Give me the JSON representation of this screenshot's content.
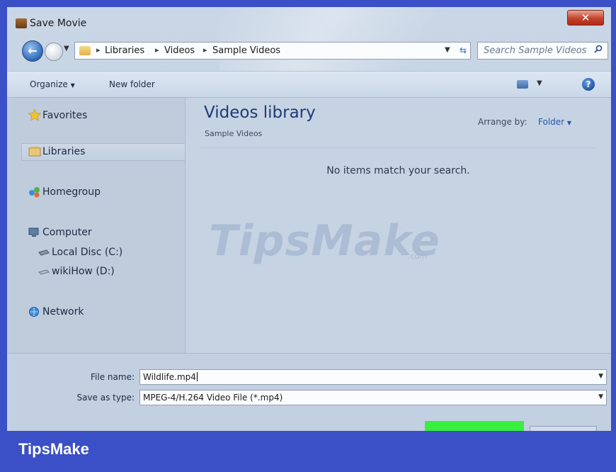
{
  "window": {
    "title": "Save Movie"
  },
  "nav": {
    "breadcrumb": [
      "Libraries",
      "Videos",
      "Sample Videos"
    ],
    "search_placeholder": "Search Sample Videos"
  },
  "toolbar": {
    "organize_label": "Organize",
    "new_folder_label": "New folder"
  },
  "sidebar": {
    "favorites": "Favorites",
    "libraries": "Libraries",
    "homegroup": "Homegroup",
    "computer": "Computer",
    "local_disc": "Local Disc (C:)",
    "wikihow_drive": "wikiHow (D:)",
    "network": "Network"
  },
  "content": {
    "title": "Videos library",
    "subtitle": "Sample Videos",
    "arrange_label": "Arrange by:",
    "arrange_value": "Folder",
    "empty_message": "No items match your search."
  },
  "form": {
    "file_name_label": "File name:",
    "file_name_value": "Wildlife.mp4",
    "save_type_label": "Save as type:",
    "save_type_value": "MPEG-4/H.264 Video File (*.mp4)"
  },
  "watermark": {
    "text": "TipsMake",
    "sub": ".com"
  },
  "footer": {
    "brand": "TipsMake"
  },
  "colors": {
    "brand_blue": "#3b4fc6",
    "highlight_green": "#39ef3f",
    "close_red": "#c4432c"
  }
}
